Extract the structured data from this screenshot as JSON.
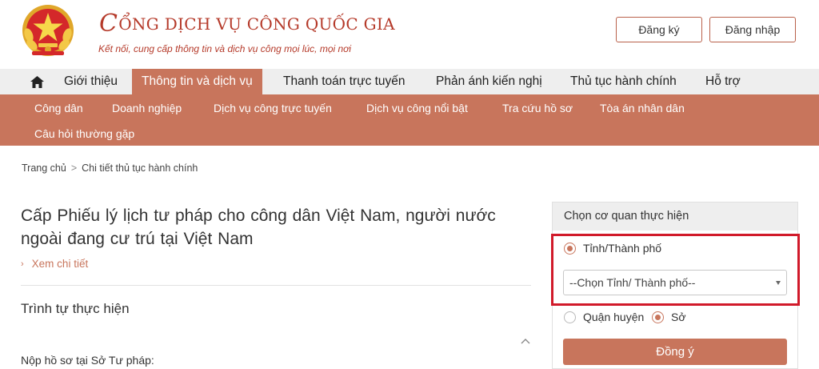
{
  "header": {
    "title_initial": "C",
    "title_rest": "ỔNG DỊCH VỤ CÔNG QUỐC GIA",
    "slogan": "Kết nối, cung cấp thông tin và dịch vụ công mọi lúc, mọi nơi",
    "register_label": "Đăng ký",
    "login_label": "Đăng nhập"
  },
  "main_nav": {
    "home_icon": "home-icon",
    "items": [
      {
        "label": "Giới thiệu",
        "active": false
      },
      {
        "label": "Thông tin và dịch vụ",
        "active": true
      },
      {
        "label": "Thanh toán trực tuyến",
        "active": false
      },
      {
        "label": "Phản ánh kiến nghị",
        "active": false
      },
      {
        "label": "Thủ tục hành chính",
        "active": false
      },
      {
        "label": "Hỗ trợ",
        "active": false
      }
    ]
  },
  "sub_nav": {
    "items": [
      "Công dân",
      "Doanh nghiệp",
      "Dịch vụ công trực tuyến",
      "Dịch vụ công nổi bật",
      "Tra cứu hồ sơ",
      "Tòa án nhân dân",
      "Câu hỏi thường gặp"
    ]
  },
  "breadcrumb": {
    "home": "Trang chủ",
    "separator": ">",
    "current": "Chi tiết thủ tục hành chính"
  },
  "procedure": {
    "title": "Cấp Phiếu lý lịch tư pháp cho công dân Việt Nam, người nước ngoài đang cư trú tại Việt Nam",
    "view_detail": "Xem chi tiết",
    "section_title": "Trình tự thực hiện",
    "section_text": "Nộp hồ sơ tại Sở Tư pháp:"
  },
  "agency_panel": {
    "header": "Chọn cơ quan thực hiện",
    "option_province": "Tỉnh/Thành phố",
    "province_selected": true,
    "province_select_value": "--Chọn Tỉnh/ Thành phố--",
    "option_district": "Quận huyện",
    "district_selected": false,
    "option_department": "Sở",
    "department_selected": true,
    "submit_label": "Đồng ý"
  },
  "colors": {
    "brand": "#b53a2a",
    "accent": "#c8755c",
    "highlight": "#d11a2a",
    "nav_bg": "#eeeeee"
  }
}
